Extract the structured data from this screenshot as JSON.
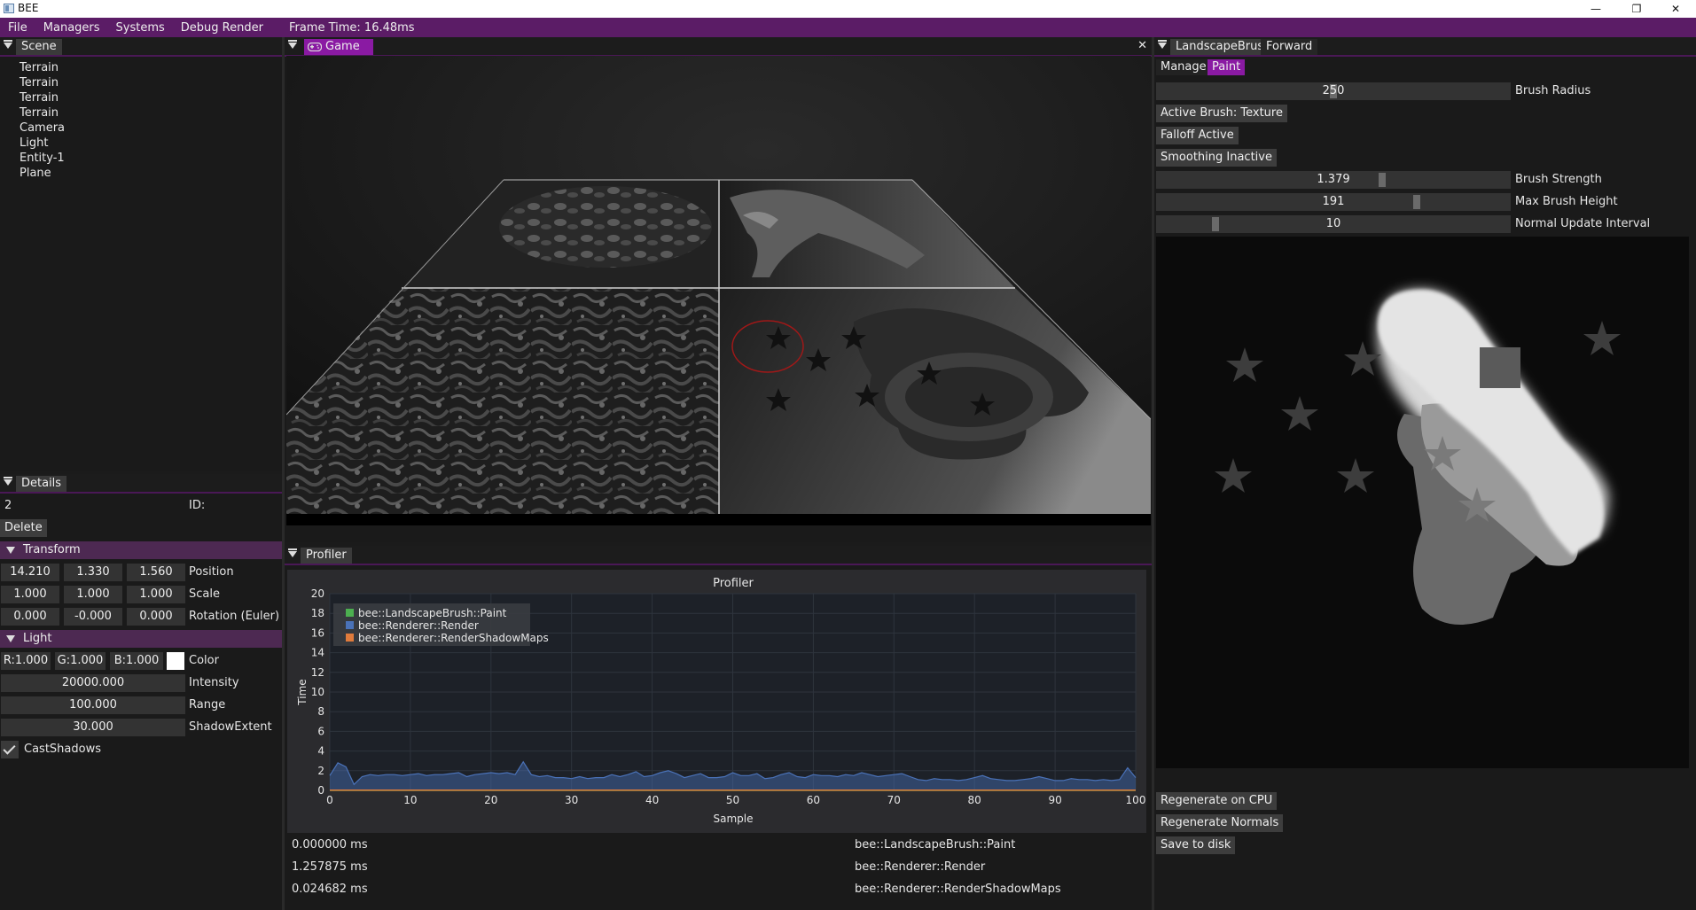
{
  "window": {
    "title": "BEE",
    "minimize_glyph": "—",
    "maximize_glyph": "❐",
    "close_glyph": "✕"
  },
  "menu": {
    "items": [
      "File",
      "Managers",
      "Systems",
      "Debug Render"
    ],
    "frame_time": "Frame Time: 16.48ms"
  },
  "scene": {
    "tab": "Scene",
    "entities": [
      "Terrain",
      "Terrain",
      "Terrain",
      "Terrain",
      "Camera",
      "Light",
      "Entity-1",
      "Plane"
    ]
  },
  "details": {
    "tab": "Details",
    "entity_value": "2",
    "id_label": "ID:",
    "delete_label": "Delete",
    "transform": {
      "header": "Transform",
      "position": [
        "14.210",
        "1.330",
        "1.560"
      ],
      "position_label": "Position",
      "scale": [
        "1.000",
        "1.000",
        "1.000"
      ],
      "scale_label": "Scale",
      "rotation": [
        "0.000",
        "-0.000",
        "0.000"
      ],
      "rotation_label": "Rotation (Euler)"
    },
    "light": {
      "header": "Light",
      "r": "R:1.000",
      "g": "G:1.000",
      "b": "B:1.000",
      "color_label": "Color",
      "color_value": "#ffffff",
      "intensity": "20000.000",
      "intensity_label": "Intensity",
      "range": "100.000",
      "range_label": "Range",
      "shadow_extent": "30.000",
      "shadow_extent_label": "ShadowExtent",
      "cast_shadows_label": "CastShadows",
      "cast_shadows": true
    }
  },
  "game": {
    "tab": "Game",
    "close_glyph": "✕"
  },
  "profiler": {
    "tab": "Profiler",
    "rows": [
      {
        "time": "0.000000 ms",
        "name": "bee::LandscapeBrush::Paint"
      },
      {
        "time": "1.257875 ms",
        "name": "bee::Renderer::Render"
      },
      {
        "time": "0.024682 ms",
        "name": "bee::Renderer::RenderShadowMaps"
      }
    ]
  },
  "chart_data": {
    "type": "area",
    "title": "Profiler",
    "xlabel": "Sample",
    "ylabel": "Time",
    "xlim": [
      0,
      100
    ],
    "ylim": [
      0,
      20
    ],
    "x_ticks": [
      0,
      10,
      20,
      30,
      40,
      50,
      60,
      70,
      80,
      90,
      100
    ],
    "y_ticks": [
      0,
      2,
      4,
      6,
      8,
      10,
      12,
      14,
      16,
      18,
      20
    ],
    "grid": true,
    "legend_position": "top-left",
    "series": [
      {
        "name": "bee::LandscapeBrush::Paint",
        "color": "#4caf50",
        "values": [
          0,
          0,
          0,
          0,
          0,
          0,
          0,
          0,
          0,
          0,
          0,
          0,
          0,
          0,
          0,
          0,
          0,
          0,
          0,
          0,
          0,
          0,
          0,
          0,
          0,
          0,
          0,
          0,
          0,
          0,
          0,
          0,
          0,
          0,
          0,
          0,
          0,
          0,
          0,
          0,
          0,
          0,
          0,
          0,
          0,
          0,
          0,
          0,
          0,
          0,
          0,
          0,
          0,
          0,
          0,
          0,
          0,
          0,
          0,
          0,
          0,
          0,
          0,
          0,
          0,
          0,
          0,
          0,
          0,
          0,
          0,
          0,
          0,
          0,
          0,
          0,
          0,
          0,
          0,
          0,
          0,
          0,
          0,
          0,
          0,
          0,
          0,
          0,
          0,
          0,
          0,
          0,
          0,
          0,
          0,
          0,
          0,
          0,
          0,
          0,
          0
        ]
      },
      {
        "name": "bee::Renderer::Render",
        "color": "#4a72b8",
        "values": [
          1.5,
          2.8,
          2.4,
          0.6,
          1.4,
          1.6,
          1.5,
          1.6,
          1.6,
          1.5,
          1.6,
          1.7,
          1.5,
          1.6,
          1.6,
          1.7,
          1.8,
          1.4,
          1.6,
          1.7,
          1.8,
          1.7,
          1.8,
          1.6,
          2.9,
          1.6,
          1.4,
          1.5,
          1.3,
          1.3,
          1.2,
          1.4,
          1.2,
          1.3,
          1.3,
          1.6,
          1.4,
          1.6,
          1.9,
          1.4,
          1.5,
          1.8,
          2.0,
          1.7,
          1.3,
          1.5,
          1.7,
          1.3,
          1.3,
          1.4,
          1.8,
          1.5,
          1.5,
          1.7,
          1.2,
          1.3,
          1.6,
          1.8,
          1.4,
          1.3,
          1.6,
          1.5,
          1.5,
          1.4,
          1.6,
          1.5,
          1.8,
          1.6,
          1.4,
          1.5,
          1.6,
          1.7,
          1.4,
          1.1,
          1.0,
          1.2,
          1.1,
          1.1,
          1.0,
          1.1,
          1.3,
          1.5,
          1.2,
          1.1,
          1.0,
          1.0,
          1.1,
          1.2,
          1.4,
          1.2,
          1.0,
          1.0,
          1.2,
          1.1,
          1.1,
          1.0,
          1.1,
          1.0,
          1.1,
          2.3,
          1.3
        ]
      },
      {
        "name": "bee::Renderer::RenderShadowMaps",
        "color": "#e07b3c",
        "values": [
          0.02,
          0.02,
          0.02,
          0.02,
          0.02,
          0.02,
          0.02,
          0.02,
          0.02,
          0.02,
          0.02,
          0.02,
          0.02,
          0.02,
          0.02,
          0.02,
          0.02,
          0.02,
          0.02,
          0.02,
          0.02,
          0.02,
          0.02,
          0.02,
          0.02,
          0.02,
          0.02,
          0.02,
          0.02,
          0.02,
          0.02,
          0.02,
          0.02,
          0.02,
          0.02,
          0.02,
          0.02,
          0.02,
          0.02,
          0.02,
          0.02,
          0.02,
          0.02,
          0.02,
          0.02,
          0.02,
          0.02,
          0.02,
          0.02,
          0.02,
          0.02,
          0.02,
          0.02,
          0.02,
          0.02,
          0.02,
          0.02,
          0.02,
          0.02,
          0.02,
          0.02,
          0.02,
          0.02,
          0.02,
          0.02,
          0.02,
          0.02,
          0.02,
          0.02,
          0.02,
          0.02,
          0.02,
          0.02,
          0.02,
          0.02,
          0.02,
          0.02,
          0.02,
          0.02,
          0.02,
          0.02,
          0.02,
          0.02,
          0.02,
          0.02,
          0.02,
          0.02,
          0.02,
          0.02,
          0.02,
          0.02,
          0.02,
          0.02,
          0.02,
          0.02,
          0.02,
          0.02,
          0.02,
          0.02,
          0.02,
          0.02
        ]
      }
    ]
  },
  "landscape": {
    "tabs": [
      "LandscapeBrush",
      "Forward"
    ],
    "subtabs": [
      "Manage",
      "Paint"
    ],
    "brush_radius": {
      "value": "250",
      "label": "Brush Radius",
      "fraction": 0.5
    },
    "active_brush": "Active Brush: Texture",
    "falloff": "Falloff Active",
    "smoothing": "Smoothing Inactive",
    "brush_strength": {
      "value": "1.379",
      "label": "Brush Strength",
      "fraction": 0.64
    },
    "max_brush_height": {
      "value": "191",
      "label": "Max Brush Height",
      "fraction": 0.74
    },
    "normal_update": {
      "value": "10",
      "label": "Normal Update Interval",
      "fraction": 0.16
    },
    "regen_cpu": "Regenerate on CPU",
    "regen_normals": "Regenerate Normals",
    "save": "Save to disk"
  },
  "colors": {
    "accent": "#8a1aa3",
    "menubar": "#5b1c66",
    "section": "#4d2952"
  }
}
